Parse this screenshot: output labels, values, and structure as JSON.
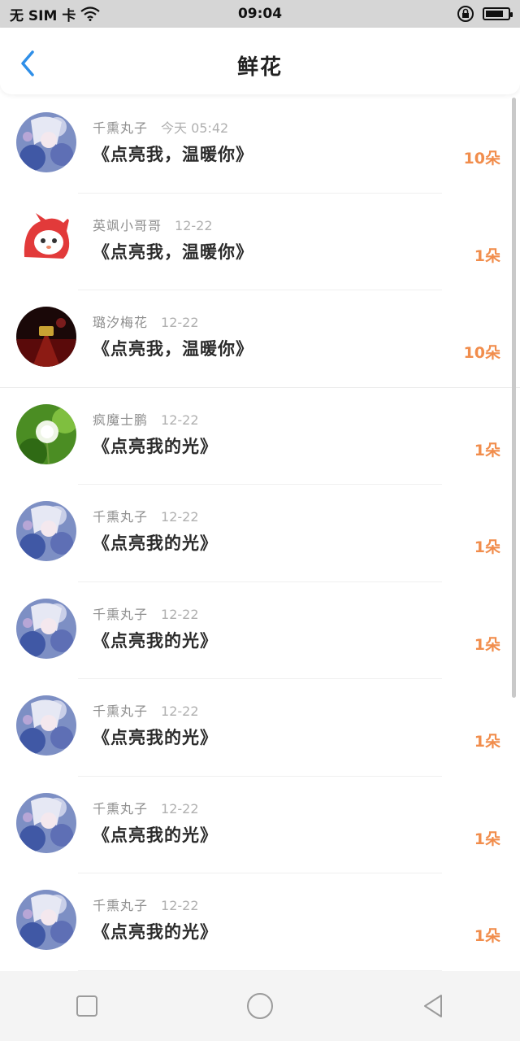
{
  "status_bar": {
    "carrier": "无 SIM 卡",
    "time": "09:04",
    "battery_level": 0.8
  },
  "nav": {
    "title": "鲜花",
    "back_icon": "chevron-left-icon",
    "accent_color": "#2f8fe8"
  },
  "list": [
    {
      "name": "千熏丸子",
      "time": "今天 05:42",
      "message": "《点亮我，温暖你》",
      "count": "10朵",
      "avatar": "anime-blue"
    },
    {
      "name": "英飒小哥哥",
      "time": "12-22",
      "message": "《点亮我，温暖你》",
      "count": "1朵",
      "avatar": "cat-red-hood"
    },
    {
      "name": "璐汐梅花",
      "time": "12-22",
      "message": "《点亮我，温暖你》",
      "count": "10朵",
      "avatar": "dark-red"
    },
    {
      "name": "疯魔士鹏",
      "time": "12-22",
      "message": "《点亮我的光》",
      "count": "1朵",
      "avatar": "dandelion"
    },
    {
      "name": "千熏丸子",
      "time": "12-22",
      "message": "《点亮我的光》",
      "count": "1朵",
      "avatar": "anime-blue"
    },
    {
      "name": "千熏丸子",
      "time": "12-22",
      "message": "《点亮我的光》",
      "count": "1朵",
      "avatar": "anime-blue"
    },
    {
      "name": "千熏丸子",
      "time": "12-22",
      "message": "《点亮我的光》",
      "count": "1朵",
      "avatar": "anime-blue"
    },
    {
      "name": "千熏丸子",
      "time": "12-22",
      "message": "《点亮我的光》",
      "count": "1朵",
      "avatar": "anime-blue"
    },
    {
      "name": "千熏丸子",
      "time": "12-22",
      "message": "《点亮我的光》",
      "count": "1朵",
      "avatar": "anime-blue"
    }
  ],
  "colors": {
    "count": "#f18d4c",
    "name": "#8f8f8f",
    "message": "#2a2a2a"
  },
  "system_nav": {
    "icons": [
      "square-icon",
      "circle-icon",
      "triangle-back-icon"
    ]
  }
}
